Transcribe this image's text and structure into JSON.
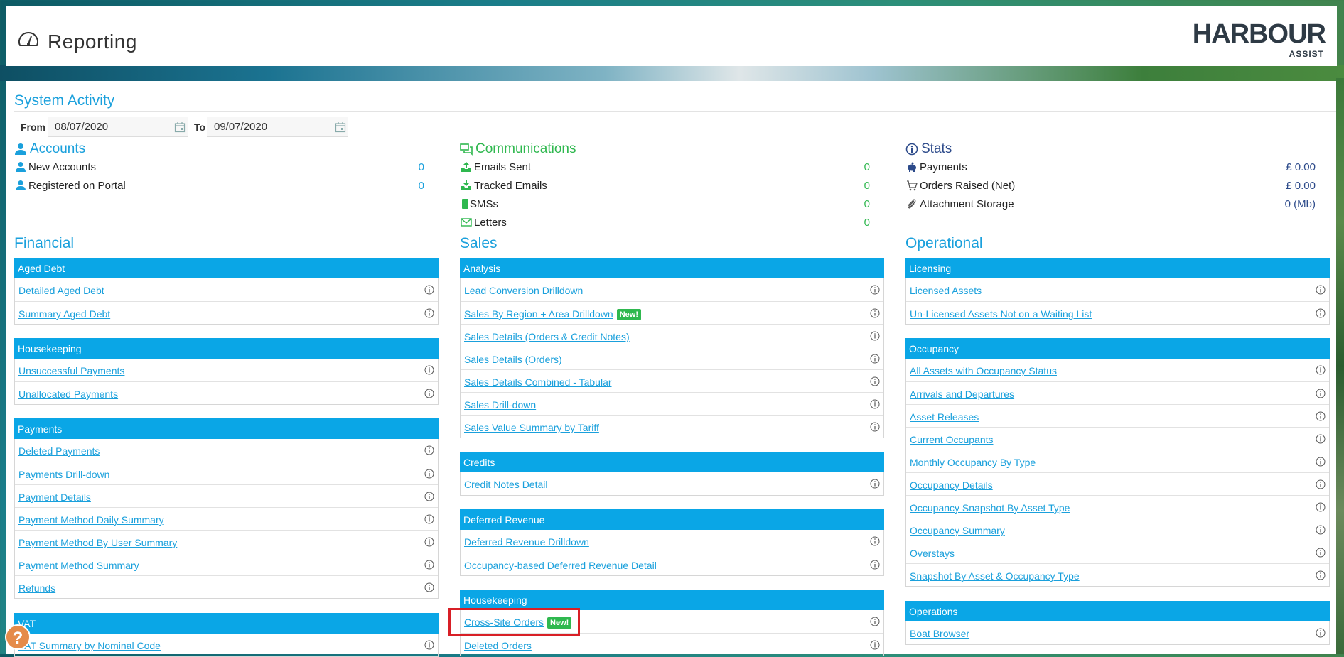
{
  "header": {
    "title": "Reporting",
    "logo_text": "HARBOUR",
    "logo_sub": "ASSIST"
  },
  "system_activity": {
    "title": "System Activity",
    "from_label": "From",
    "from_value": "08/07/2020",
    "to_label": "To",
    "to_value": "09/07/2020"
  },
  "accounts": {
    "title": "Accounts",
    "rows": [
      {
        "label": "New Accounts",
        "value": "0"
      },
      {
        "label": "Registered on Portal",
        "value": "0"
      }
    ]
  },
  "communications": {
    "title": "Communications",
    "rows": [
      {
        "label": "Emails Sent",
        "value": "0"
      },
      {
        "label": "Tracked Emails",
        "value": "0"
      },
      {
        "label": "SMSs",
        "value": "0"
      },
      {
        "label": "Letters",
        "value": "0"
      }
    ]
  },
  "stats": {
    "title": "Stats",
    "rows": [
      {
        "label": "Payments",
        "value": "£ 0.00"
      },
      {
        "label": "Orders Raised (Net)",
        "value": "£ 0.00"
      },
      {
        "label": "Attachment Storage",
        "value": "0 (Mb)"
      }
    ]
  },
  "financial": {
    "title": "Financial",
    "panels": [
      {
        "title": "Aged Debt",
        "items": [
          "Detailed Aged Debt",
          "Summary Aged Debt"
        ]
      },
      {
        "title": "Housekeeping",
        "items": [
          "Unsuccessful Payments",
          "Unallocated Payments"
        ]
      },
      {
        "title": "Payments",
        "items": [
          "Deleted Payments",
          "Payments Drill-down",
          "Payment Details",
          "Payment Method Daily Summary",
          "Payment Method By User Summary",
          "Payment Method Summary",
          "Refunds"
        ]
      },
      {
        "title": "VAT",
        "items": [
          "VAT Summary by Nominal Code"
        ]
      }
    ]
  },
  "sales": {
    "title": "Sales",
    "panels": [
      {
        "title": "Analysis",
        "items": [
          "Lead Conversion Drilldown",
          "Sales By Region + Area Drilldown",
          "Sales Details (Orders & Credit Notes)",
          "Sales Details (Orders)",
          "Sales Details Combined - Tabular",
          "Sales Drill-down",
          "Sales Value Summary by Tariff"
        ]
      },
      {
        "title": "Credits",
        "items": [
          "Credit Notes Detail"
        ]
      },
      {
        "title": "Deferred Revenue",
        "items": [
          "Deferred Revenue Drilldown",
          "Occupancy-based Deferred Revenue Detail"
        ]
      },
      {
        "title": "Housekeeping",
        "items": [
          "Cross-Site Orders",
          "Deleted Orders"
        ]
      }
    ],
    "new_badge": "New!"
  },
  "operational": {
    "title": "Operational",
    "panels": [
      {
        "title": "Licensing",
        "items": [
          "Licensed Assets",
          "Un-Licensed Assets Not on a Waiting List"
        ]
      },
      {
        "title": "Occupancy",
        "items": [
          "All Assets with Occupancy Status",
          "Arrivals and Departures",
          "Asset Releases",
          "Current Occupants",
          "Monthly Occupancy By Type",
          "Occupancy Details",
          "Occupancy Snapshot By Asset Type",
          "Occupancy Summary",
          "Overstays",
          "Snapshot By Asset & Occupancy Type"
        ]
      },
      {
        "title": "Operations",
        "items": [
          "Boat Browser"
        ]
      }
    ]
  },
  "help_button": "?",
  "colors": {
    "accent": "#1aa0dc",
    "panel_header": "#0aa6e6",
    "green": "#2fb84f",
    "stats_blue": "#2c4a8a"
  }
}
